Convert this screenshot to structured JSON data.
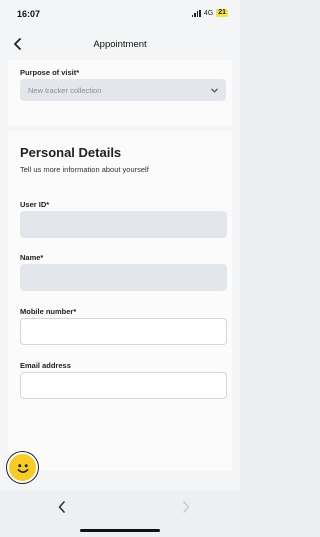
{
  "status_bar": {
    "time": "16:07",
    "network": "4G",
    "battery": "21"
  },
  "header": {
    "title": "Appointment",
    "back_icon": "chevron-left-icon"
  },
  "purpose": {
    "label": "Purpose of visit*",
    "value": "New tracker collection",
    "icon": "chevron-down-icon"
  },
  "personal_details": {
    "title": "Personal Details",
    "subtitle": "Tell us more information about yourself",
    "fields": [
      {
        "label": "User ID*",
        "value": "",
        "state": "disabled"
      },
      {
        "label": "Name*",
        "value": "",
        "state": "disabled"
      },
      {
        "label": "Mobile number*",
        "value": "",
        "state": "editable"
      },
      {
        "label": "Email address",
        "value": "",
        "state": "editable"
      }
    ]
  },
  "feedback_button": {
    "icon": "smiley-face-icon",
    "color": "#f6cb2a"
  },
  "bottom_nav": {
    "back_icon": "chevron-left-icon",
    "forward_icon": "chevron-right-icon"
  }
}
